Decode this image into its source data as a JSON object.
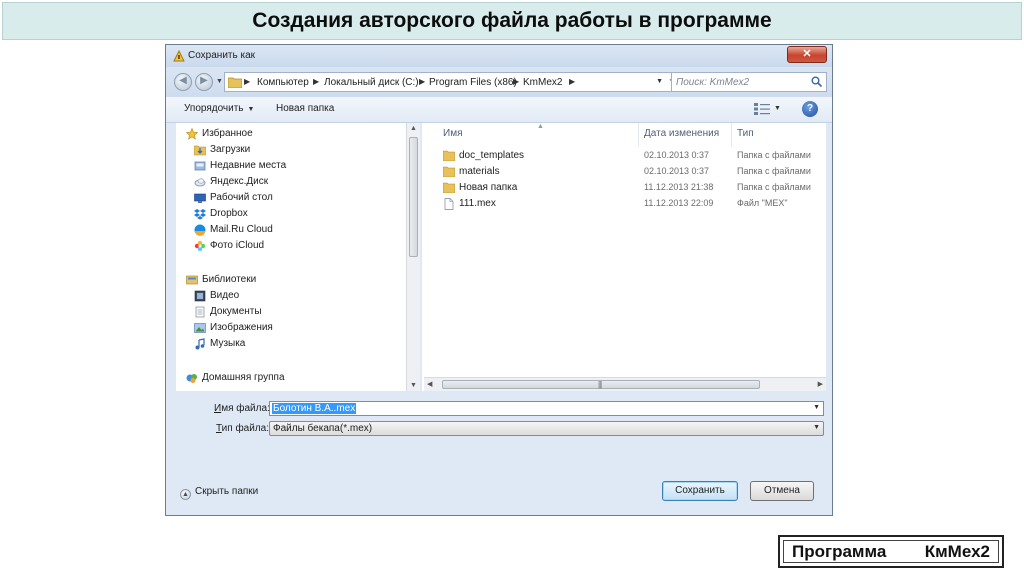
{
  "slide": {
    "title": "Создания  авторского  файла работы  в программе",
    "footer": {
      "label": "Программа",
      "value": "КмМех2"
    }
  },
  "dialog": {
    "title": "Сохранить как",
    "close_label": "✕",
    "address": {
      "crumbs": [
        "Компьютер",
        "Локальный диск (C:)",
        "Program Files (x86)",
        "KmMex2"
      ],
      "search_placeholder": "Поиск: KmMex2"
    },
    "toolbar": {
      "organize": "Упорядочить",
      "new_folder": "Новая папка",
      "help": "?"
    },
    "nav": {
      "favorites_header": "Избранное",
      "favorites": [
        {
          "label": "Загрузки",
          "icon": "downloads-icon"
        },
        {
          "label": "Недавние места",
          "icon": "recent-places-icon"
        },
        {
          "label": "Яндекс.Диск",
          "icon": "yandex-disk-icon"
        },
        {
          "label": "Рабочий стол",
          "icon": "desktop-icon"
        },
        {
          "label": "Dropbox",
          "icon": "dropbox-icon"
        },
        {
          "label": "Mail.Ru Cloud",
          "icon": "mailru-cloud-icon"
        },
        {
          "label": "Фото iCloud",
          "icon": "icloud-photos-icon"
        }
      ],
      "libraries_header": "Библиотеки",
      "libraries": [
        {
          "label": "Видео",
          "icon": "video-library-icon"
        },
        {
          "label": "Документы",
          "icon": "documents-library-icon"
        },
        {
          "label": "Изображения",
          "icon": "images-library-icon"
        },
        {
          "label": "Музыка",
          "icon": "music-library-icon"
        }
      ],
      "homegroup": "Домашняя группа"
    },
    "files": {
      "columns": {
        "name": "Имя",
        "date": "Дата изменения",
        "type": "Тип"
      },
      "rows": [
        {
          "name": "doc_templates",
          "date": "02.10.2013 0:37",
          "type": "Папка с файлами",
          "kind": "folder"
        },
        {
          "name": "materials",
          "date": "02.10.2013 0:37",
          "type": "Папка с файлами",
          "kind": "folder"
        },
        {
          "name": "Новая папка",
          "date": "11.12.2013 21:38",
          "type": "Папка с файлами",
          "kind": "folder"
        },
        {
          "name": "111.mex",
          "date": "11.12.2013 22:09",
          "type": "Файл \"MEX\"",
          "kind": "file"
        }
      ]
    },
    "form": {
      "filename_label_u": "И",
      "filename_label_rest": "мя файла:",
      "filename_value": "Болотин В.А..mex",
      "filetype_label_u": "Т",
      "filetype_label_rest": "ип файла:",
      "filetype_value": "Файлы бекапа(*.mex)"
    },
    "footer": {
      "hide_folders": "Скрыть папки",
      "save": "Сохранить",
      "cancel": "Отмена"
    }
  }
}
